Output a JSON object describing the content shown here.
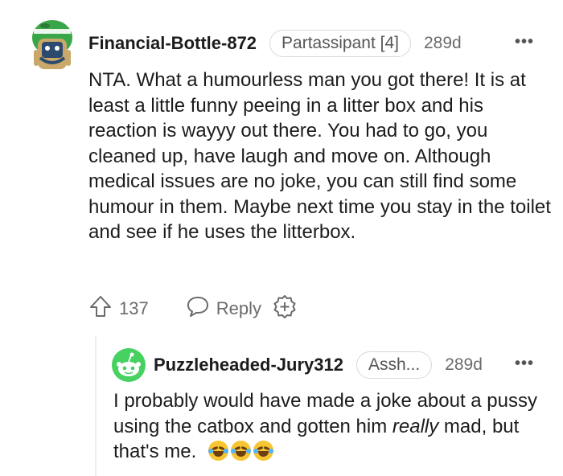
{
  "comments": [
    {
      "username": "Financial-Bottle-872",
      "flair": "Partassipant [4]",
      "age": "289d",
      "more": "•••",
      "body": "NTA. What a humourless man you got there! It is at least a little funny peeing in a litter box and his reaction is wayyy out there. You had to go, you cleaned up, have laugh and move on. Although medical issues are no joke, you can still find some humour in them. Maybe next time you stay in the toilet and see if he uses the litterbox.",
      "votes": "137",
      "reply_label": "Reply"
    },
    {
      "username": "Puzzleheaded-Jury312",
      "flair": "Assh...",
      "age": "289d",
      "more": "•••",
      "body_before": "I probably would have made a joke about a pussy using the catbox and gotten him ",
      "body_emphasis": "really",
      "body_after": " mad, but that's me.",
      "emojis": [
        "rofl",
        "rofl",
        "rofl"
      ]
    }
  ],
  "colors": {
    "avatar1_green": "#3aa64a",
    "avatar2_green": "#46d160",
    "text": "#1c1c1c",
    "muted": "#6b6b6b"
  }
}
